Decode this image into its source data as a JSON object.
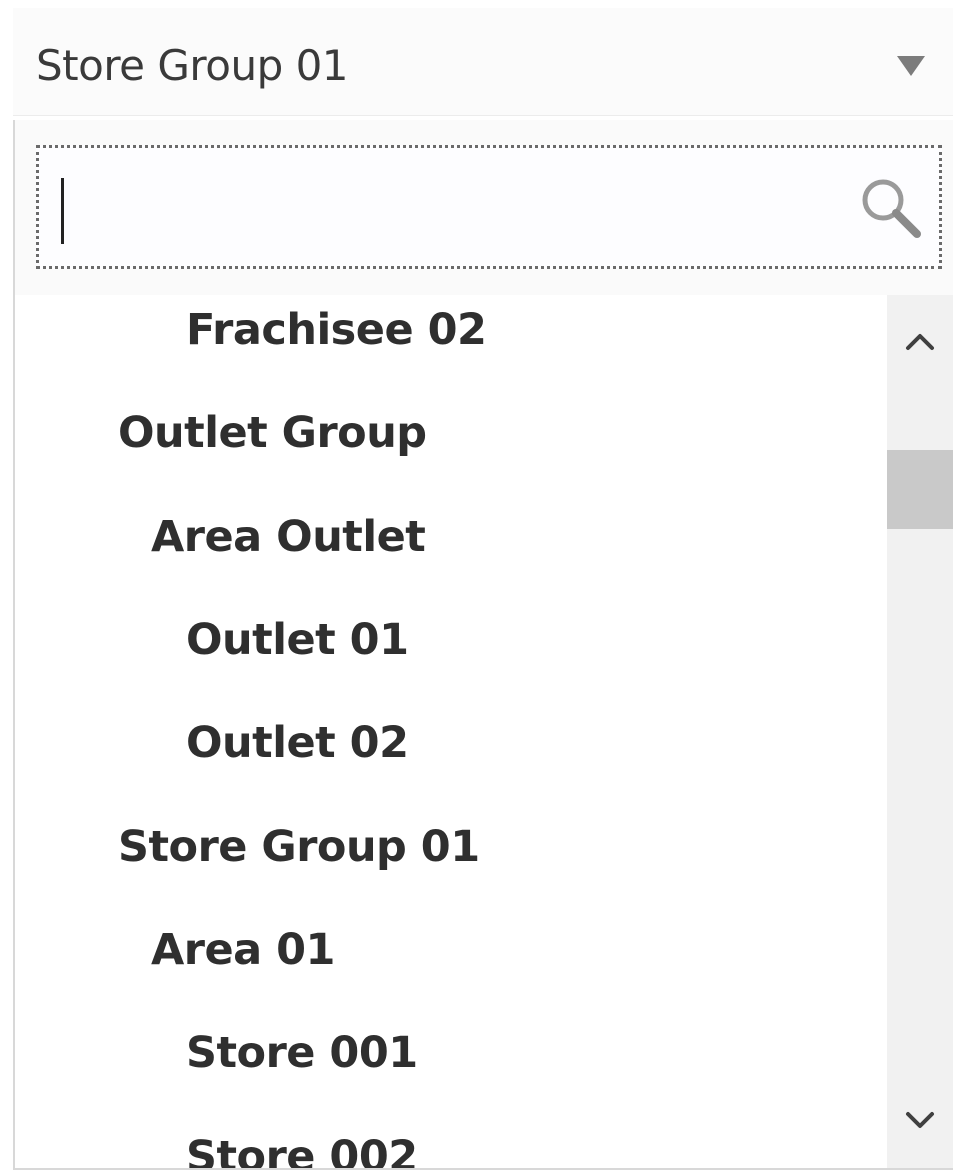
{
  "select": {
    "value": "Store Group 01"
  },
  "search": {
    "value": "",
    "placeholder": ""
  },
  "list": {
    "items": [
      {
        "label": "Frachisee 02"
      },
      {
        "label": "Outlet Group"
      },
      {
        "label": "Area Outlet"
      },
      {
        "label": "Outlet 01"
      },
      {
        "label": "Outlet 02"
      },
      {
        "label": "Store Group 01"
      },
      {
        "label": "Area 01"
      },
      {
        "label": "Store 001"
      },
      {
        "label": "Store 002"
      }
    ]
  },
  "colors": {
    "text": "#2f2f2f",
    "scroll_thumb": "#c9c9c9",
    "scroll_track": "#f1f1f1",
    "dropdown_arrow": "#7c7c7c"
  },
  "icons": {
    "dropdown": "triangle-down",
    "search": "magnifier",
    "scroll_up": "chevron-up",
    "scroll_down": "chevron-down"
  }
}
